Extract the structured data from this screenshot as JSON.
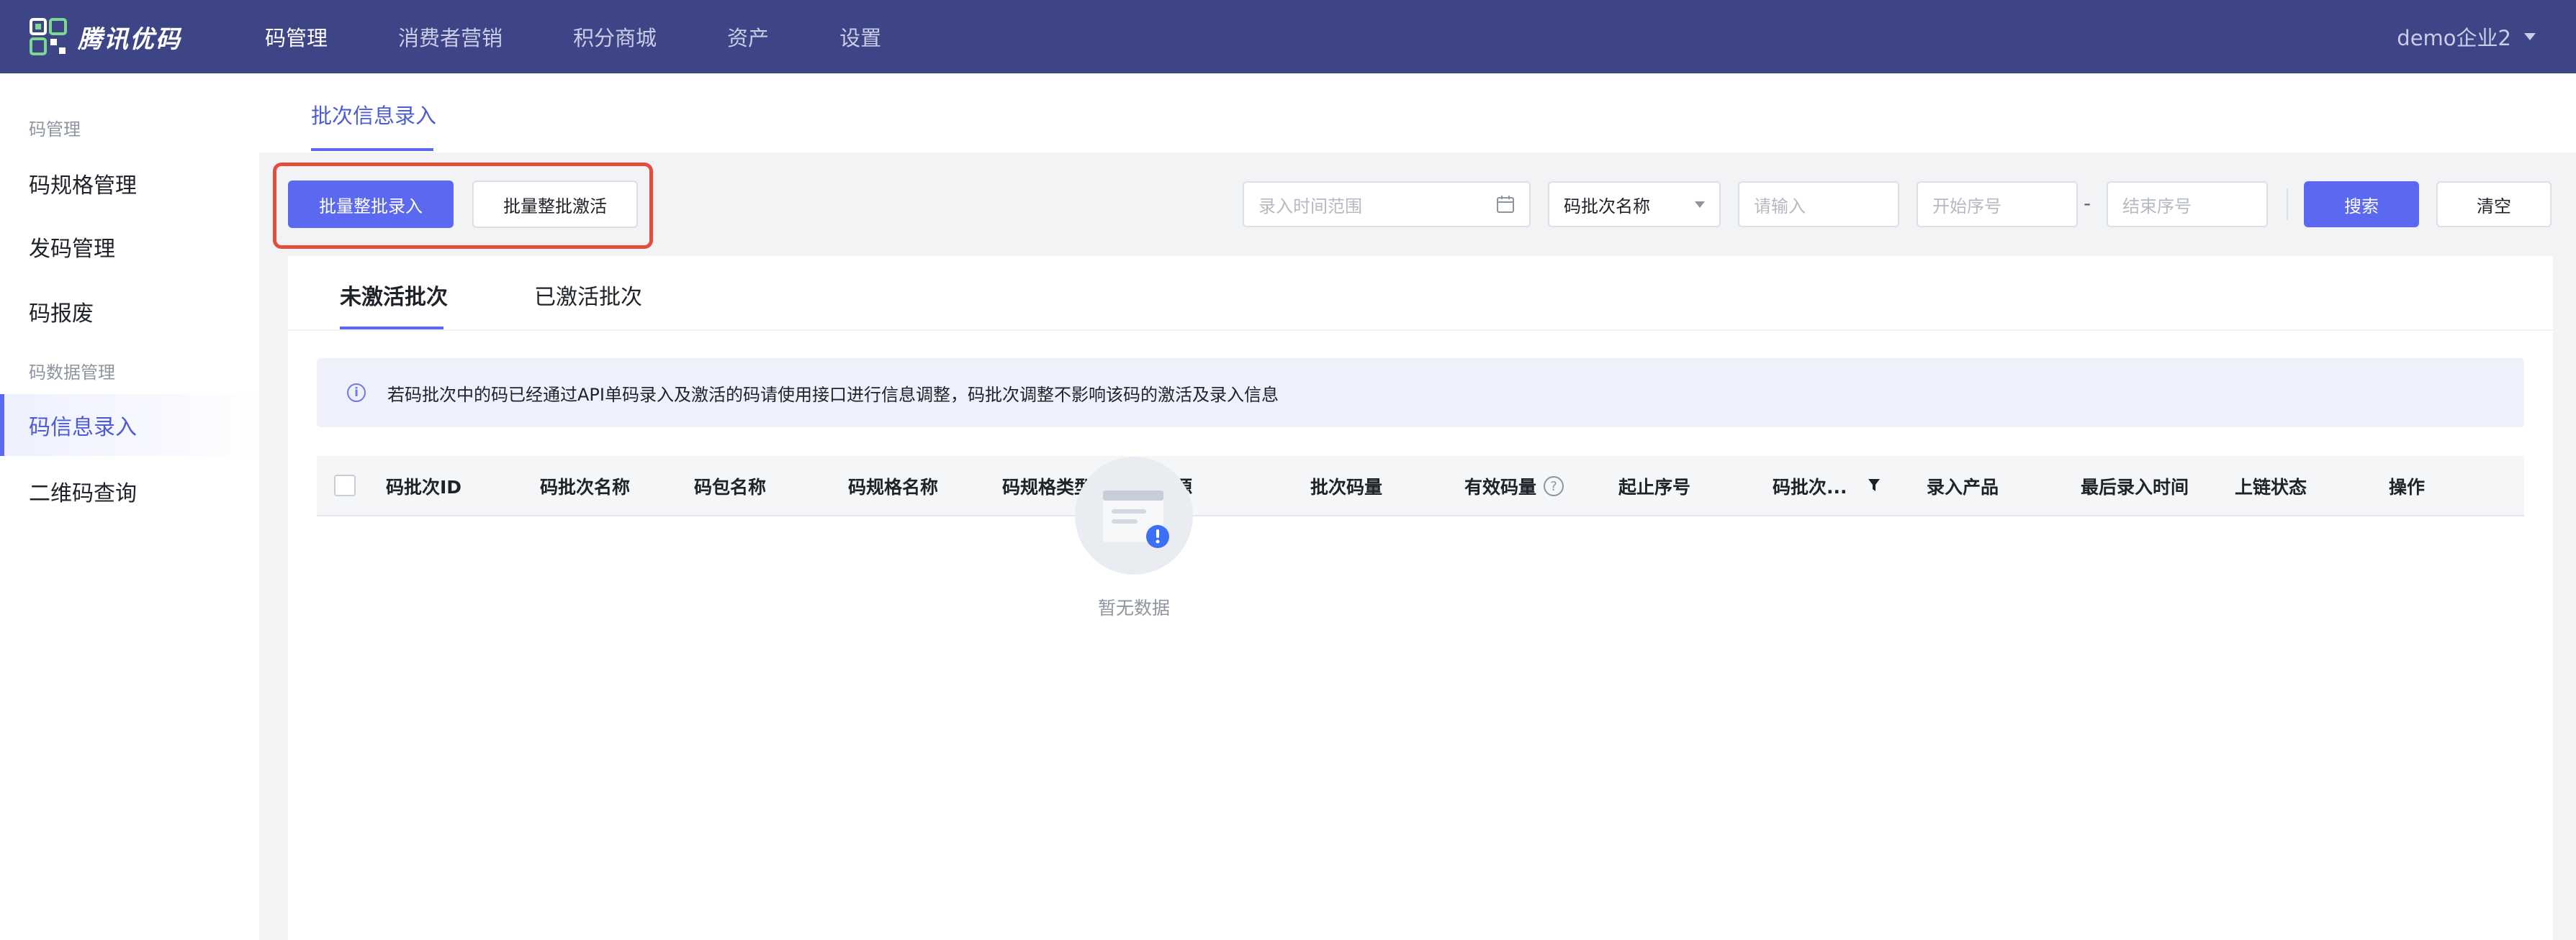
{
  "brand": {
    "name": "腾讯优码"
  },
  "nav": {
    "items": [
      {
        "label": "码管理"
      },
      {
        "label": "消费者营销"
      },
      {
        "label": "积分商城"
      },
      {
        "label": "资产"
      },
      {
        "label": "设置"
      }
    ]
  },
  "user": {
    "name": "demo企业2"
  },
  "sidebar": {
    "group1": "码管理",
    "items1": [
      {
        "label": "码规格管理"
      },
      {
        "label": "发码管理"
      },
      {
        "label": "码报废"
      }
    ],
    "group2": "码数据管理",
    "items2": [
      {
        "label": "码信息录入"
      },
      {
        "label": "二维码查询"
      }
    ]
  },
  "page": {
    "tab": "批次信息录入"
  },
  "toolbar": {
    "batch_import": "批量整批录入",
    "batch_activate": "批量整批激活",
    "time_range_placeholder": "录入时间范围",
    "batch_name_select": "码批次名称",
    "input_placeholder": "请输入",
    "start_seq_placeholder": "开始序号",
    "range_sep": "-",
    "end_seq_placeholder": "结束序号",
    "search": "搜索",
    "clear": "清空"
  },
  "tabs": [
    {
      "label": "未激活批次"
    },
    {
      "label": "已激活批次"
    }
  ],
  "notice": {
    "icon": "i",
    "text": "若码批次中的码已经通过API单码录入及激活的码请使用接口进行信息调整，码批次调整不影响该码的激活及录入信息"
  },
  "table": {
    "columns": [
      "码批次ID",
      "码批次名称",
      "码包名称",
      "码规格名称",
      "码规格类型",
      "码源",
      "批次码量",
      "有效码量",
      "起止序号",
      "码批次...",
      "录入产品",
      "最后录入时间",
      "上链状态",
      "操作"
    ],
    "help_glyph": "?"
  },
  "empty": {
    "text": "暂无数据"
  },
  "colors": {
    "topbar": "#3d4587",
    "primary": "#5b68f0",
    "highlight": "#e34d3d"
  }
}
